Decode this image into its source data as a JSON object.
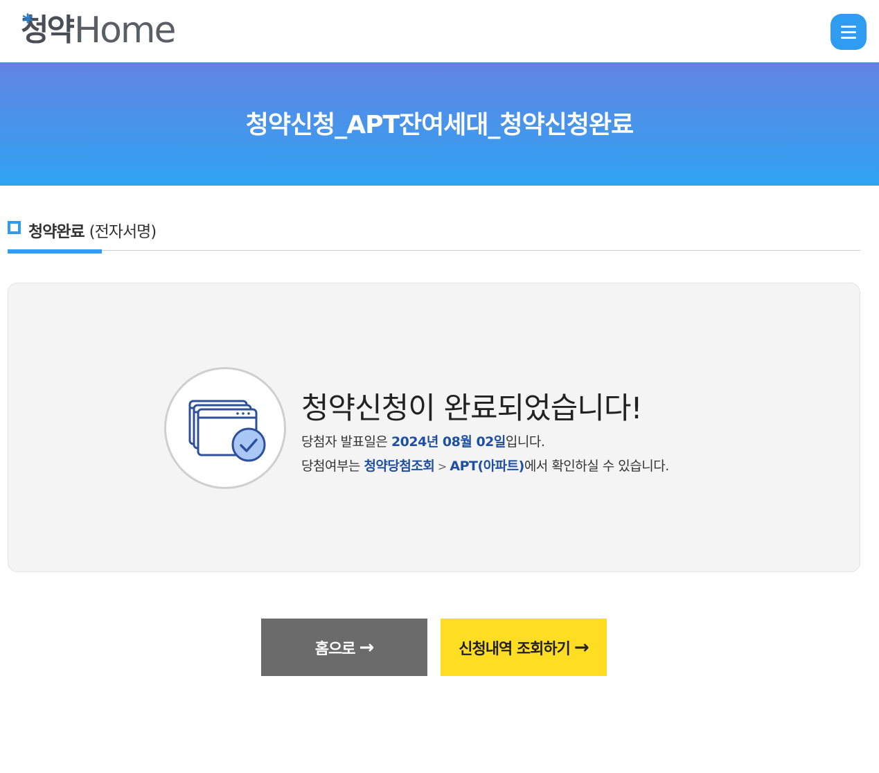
{
  "header": {
    "logo_kr": "청약",
    "logo_en": "Home",
    "logo_star": "*",
    "menu_icon": "hamburger-menu-icon"
  },
  "banner": {
    "title": "청약신청_APT잔여세대_청약신청완료"
  },
  "section": {
    "title": "청약완료",
    "subtitle": "(전자서명)"
  },
  "result": {
    "heading": "청약신청이 완료되었습니다!",
    "announce_prefix": "당첨자 발표일은 ",
    "announce_date": "2024년 08월 02일",
    "announce_suffix": "입니다.",
    "check_prefix": "당첨여부는 ",
    "check_link1": "청약당첨조회",
    "check_sep": " > ",
    "check_link2": "APT(아파트)",
    "check_suffix": "에서 확인하실 수 있습니다.",
    "icon": "windows-check-icon"
  },
  "buttons": {
    "home_label": "홈으로",
    "history_label": "신청내역 조회하기",
    "arrow": "→"
  },
  "colors": {
    "accent": "#2e9cf0",
    "banner_top": "#6184e3",
    "banner_bottom": "#2fa3f2",
    "highlight_text": "#1f4fa3",
    "home_button": "#6b6b6b",
    "history_button": "#ffdd22"
  }
}
